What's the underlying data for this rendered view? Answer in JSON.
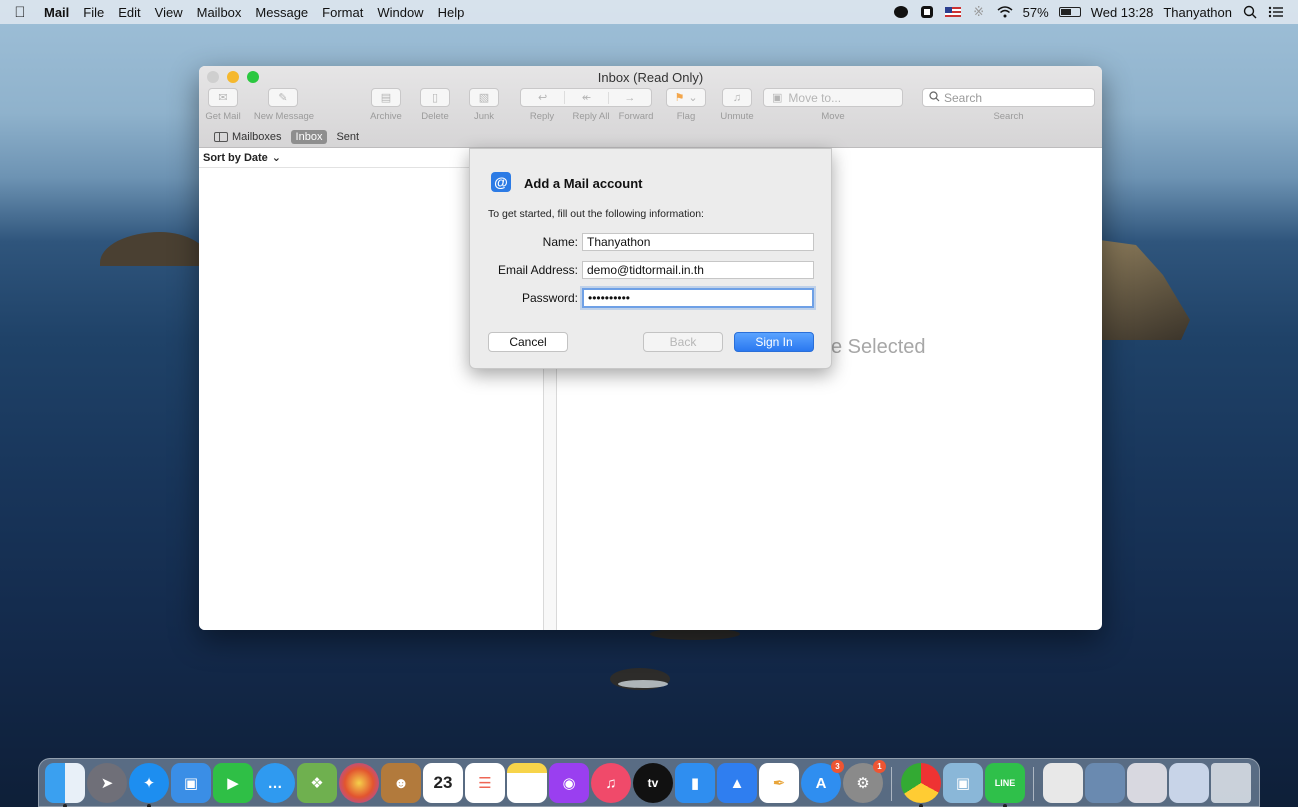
{
  "menubar": {
    "app_name": "Mail",
    "items": [
      "File",
      "Edit",
      "View",
      "Mailbox",
      "Message",
      "Format",
      "Window",
      "Help"
    ],
    "battery_pct": "57%",
    "battery_level": 0.57,
    "clock": "Wed 13:28",
    "user": "Thanyathon"
  },
  "window": {
    "title": "Inbox (Read Only)",
    "toolbar": {
      "get_mail": "Get Mail",
      "new_message": "New Message",
      "archive": "Archive",
      "delete": "Delete",
      "junk": "Junk",
      "reply": "Reply",
      "reply_all": "Reply All",
      "forward": "Forward",
      "flag": "Flag",
      "unmute": "Unmute",
      "move_to": "Move to...",
      "move": "Move",
      "search_placeholder": "Search",
      "search_label": "Search"
    },
    "favorites": {
      "mailboxes": "Mailboxes",
      "inbox": "Inbox",
      "sent": "Sent"
    },
    "sort_label": "Sort by Date",
    "no_message": "e Selected"
  },
  "sheet": {
    "title": "Add a Mail account",
    "subtitle": "To get started, fill out the following information:",
    "name_label": "Name:",
    "name_value": "Thanyathon",
    "email_label": "Email Address:",
    "email_value": "demo@tidtormail.in.th",
    "password_label": "Password:",
    "password_value": "••••••••••",
    "cancel": "Cancel",
    "back": "Back",
    "sign_in": "Sign In"
  },
  "dock": {
    "calendar_day": "23",
    "app_store_badge": "3",
    "prefs_badge": "1",
    "tv_label": "tv",
    "line_label": "LINE"
  },
  "colors": {
    "accent": "#2a78f0",
    "close": "#cfcfcf",
    "minimize": "#f5b82e",
    "zoom": "#2bc840"
  }
}
